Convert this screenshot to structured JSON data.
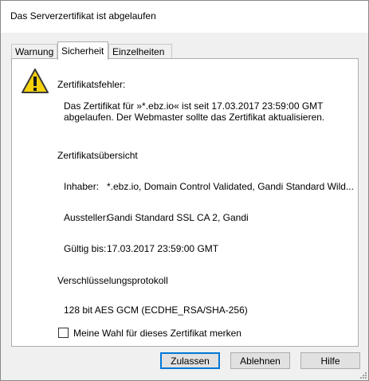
{
  "window": {
    "title": "Das Serverzertifikat ist abgelaufen"
  },
  "tabs": [
    {
      "label": "Warnung",
      "active": false
    },
    {
      "label": "Sicherheit",
      "active": true
    },
    {
      "label": "Einzelheiten",
      "active": false
    }
  ],
  "security": {
    "error_heading": "Zertifikatsfehler:",
    "error_line1": "Das Zertifikat für »*.ebz.io« ist seit 17.03.2017 23:59:00 GMT",
    "error_line2": "abgelaufen. Der Webmaster sollte das Zertifikat aktualisieren.",
    "overview_heading": "Zertifikatsübersicht",
    "owner_label": "Inhaber:",
    "owner_value": "*.ebz.io, Domain Control Validated, Gandi Standard Wild...",
    "issuer_label": "Aussteller:",
    "issuer_value": "Gandi Standard SSL CA 2, Gandi",
    "valid_label": "Gültig bis:",
    "valid_value": "17.03.2017 23:59:00 GMT",
    "protocol_heading": "Verschlüsselungsprotokoll",
    "protocol_value": "128 bit AES GCM (ECDHE_RSA/SHA-256)",
    "remember_label": "Meine Wahl für dieses Zertifikat merken",
    "remember_checked": false
  },
  "buttons": {
    "allow": "Zulassen",
    "deny": "Ablehnen",
    "help": "Hilfe"
  },
  "icons": {
    "warning": "warning-icon",
    "resize": "resize-grip-icon"
  },
  "colors": {
    "warning_fill": "#f5d20c",
    "focus_border": "#0078d7",
    "dialog_bg": "#f0f0f0"
  }
}
